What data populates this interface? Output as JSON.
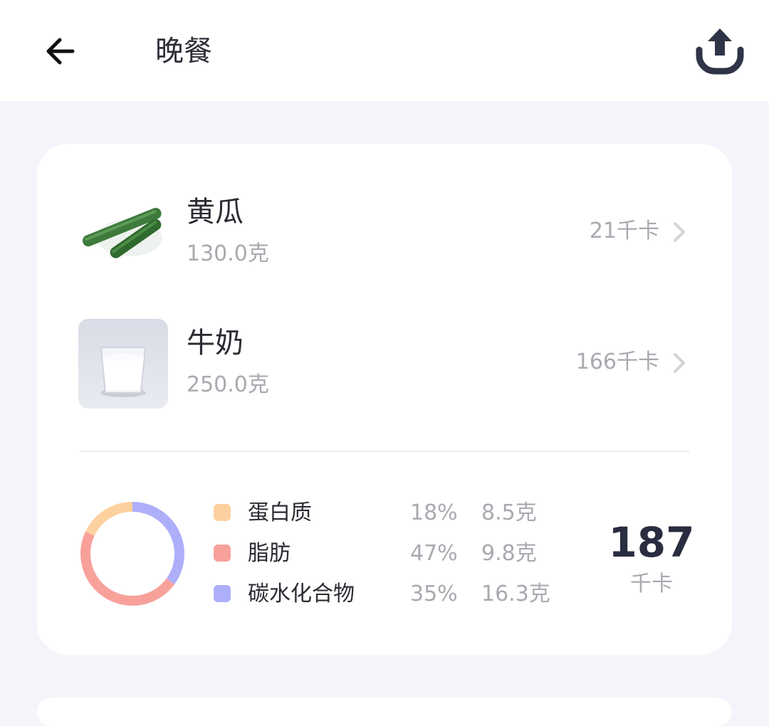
{
  "header": {
    "title": "晚餐",
    "back_icon": "arrow-left-icon",
    "share_icon": "share-upload-icon"
  },
  "meal": {
    "items": [
      {
        "name": "黄瓜",
        "weight": "130.0克",
        "calories": "21千卡",
        "image": "cucumber-image"
      },
      {
        "name": "牛奶",
        "weight": "250.0克",
        "calories": "166千卡",
        "image": "milk-glass-image"
      }
    ]
  },
  "nutrition": {
    "legend": [
      {
        "name": "蛋白质",
        "percent": "18%",
        "amount": "8.5克",
        "color": "#fdd19f"
      },
      {
        "name": "脂肪",
        "percent": "47%",
        "amount": "9.8克",
        "color": "#f8a19b"
      },
      {
        "name": "碳水化合物",
        "percent": "35%",
        "amount": "16.3克",
        "color": "#adaffa"
      }
    ],
    "total_value": "187",
    "total_unit": "千卡"
  },
  "colors": {
    "background": "#f4f5fa",
    "card": "#ffffff",
    "text_primary": "#2b2b33",
    "text_secondary": "#a9a9b0",
    "protein": "#fdd19f",
    "fat": "#f8a19b",
    "carb": "#adaffa"
  }
}
